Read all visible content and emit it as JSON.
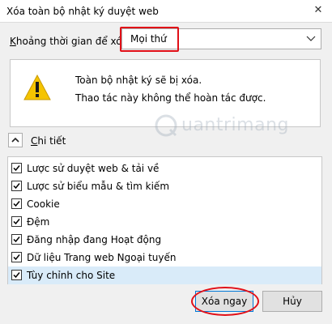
{
  "window": {
    "title": "Xóa toàn bộ nhật ký duyệt web",
    "close_label": "✕"
  },
  "time_range": {
    "label_accel": "K",
    "label_rest": "hoảng thời gian để xóa:",
    "selected": "Mọi thứ"
  },
  "warning": {
    "line1": "Toàn bộ nhật ký sẽ bị xóa.",
    "line2": "Thao tác này không thể hoàn tác được."
  },
  "watermark": {
    "text": "uantrimang"
  },
  "details": {
    "label_accel": "C",
    "label_rest": "hi tiết"
  },
  "items": [
    {
      "label": "Lược sử duyệt web & tải về",
      "checked": true
    },
    {
      "label": "Lược sử biểu mẫu & tìm kiếm",
      "checked": true
    },
    {
      "label": "Cookie",
      "checked": true
    },
    {
      "label": "Đệm",
      "checked": true
    },
    {
      "label": "Đăng nhập đang Hoạt động",
      "checked": true
    },
    {
      "label": "Dữ liệu Trang web Ngoại tuyến",
      "checked": true
    },
    {
      "label": "Tùy chỉnh cho Site",
      "checked": true,
      "selected": true
    }
  ],
  "buttons": {
    "clear_now": "Xóa ngay",
    "cancel": "Hủy"
  },
  "colors": {
    "highlight": "#e10f17",
    "warning_yellow": "#f5c400",
    "selection": "#d9ebf9"
  }
}
